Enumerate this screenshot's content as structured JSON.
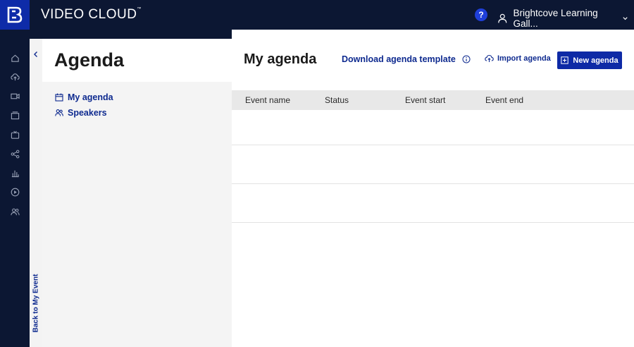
{
  "app": {
    "brand": "VIDEO CLOUD",
    "brand_mark": "™",
    "help_label": "?",
    "account_name": "Brightcove Learning Gall..."
  },
  "rail": {
    "icons": [
      "home-icon",
      "upload-icon",
      "video-icon",
      "media-icon",
      "tv-icon",
      "share-icon",
      "analytics-icon",
      "play-icon",
      "users-icon"
    ]
  },
  "back_panel": {
    "label": "Back to My Event"
  },
  "sidebar": {
    "title": "Agenda",
    "items": [
      {
        "label": "My agenda",
        "icon": "calendar-icon"
      },
      {
        "label": "Speakers",
        "icon": "people-icon"
      }
    ]
  },
  "main": {
    "title": "My agenda",
    "download_label": "Download agenda template",
    "import_label": "Import agenda",
    "new_label": "New agenda",
    "columns": [
      "Event name",
      "Status",
      "Event start",
      "Event end"
    ],
    "rows": [
      {},
      {},
      {}
    ]
  },
  "colors": {
    "nav_bg": "#0c1733",
    "accent": "#0e2aa6",
    "link": "#0e2a8f"
  }
}
